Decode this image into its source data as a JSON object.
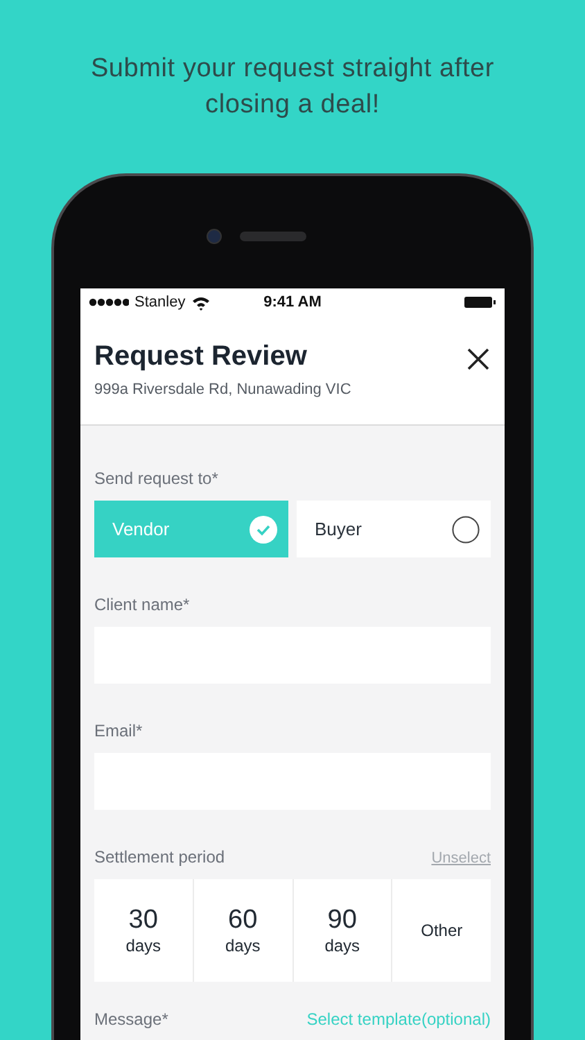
{
  "headline": "Submit your request straight after closing a deal!",
  "status_bar": {
    "carrier": "Stanley",
    "time": "9:41 AM"
  },
  "header": {
    "title": "Request Review",
    "subtitle": "999a Riversdale Rd, Nunawading VIC"
  },
  "send_to": {
    "label": "Send request to*",
    "options": [
      {
        "label": "Vendor",
        "selected": true
      },
      {
        "label": "Buyer",
        "selected": false
      }
    ]
  },
  "fields": [
    {
      "label": "Client name*"
    },
    {
      "label": "Email*"
    }
  ],
  "settlement": {
    "label": "Settlement period",
    "unselect": "Unselect",
    "options": [
      {
        "value": "30",
        "unit": "days",
        "selected": false
      },
      {
        "value": "60",
        "unit": "days",
        "selected": false
      },
      {
        "value": "90",
        "unit": "days",
        "selected": false
      },
      {
        "value": "Other",
        "selected": false
      }
    ]
  },
  "message": {
    "label": "Message*",
    "template_link": "Select template(optional)"
  }
}
